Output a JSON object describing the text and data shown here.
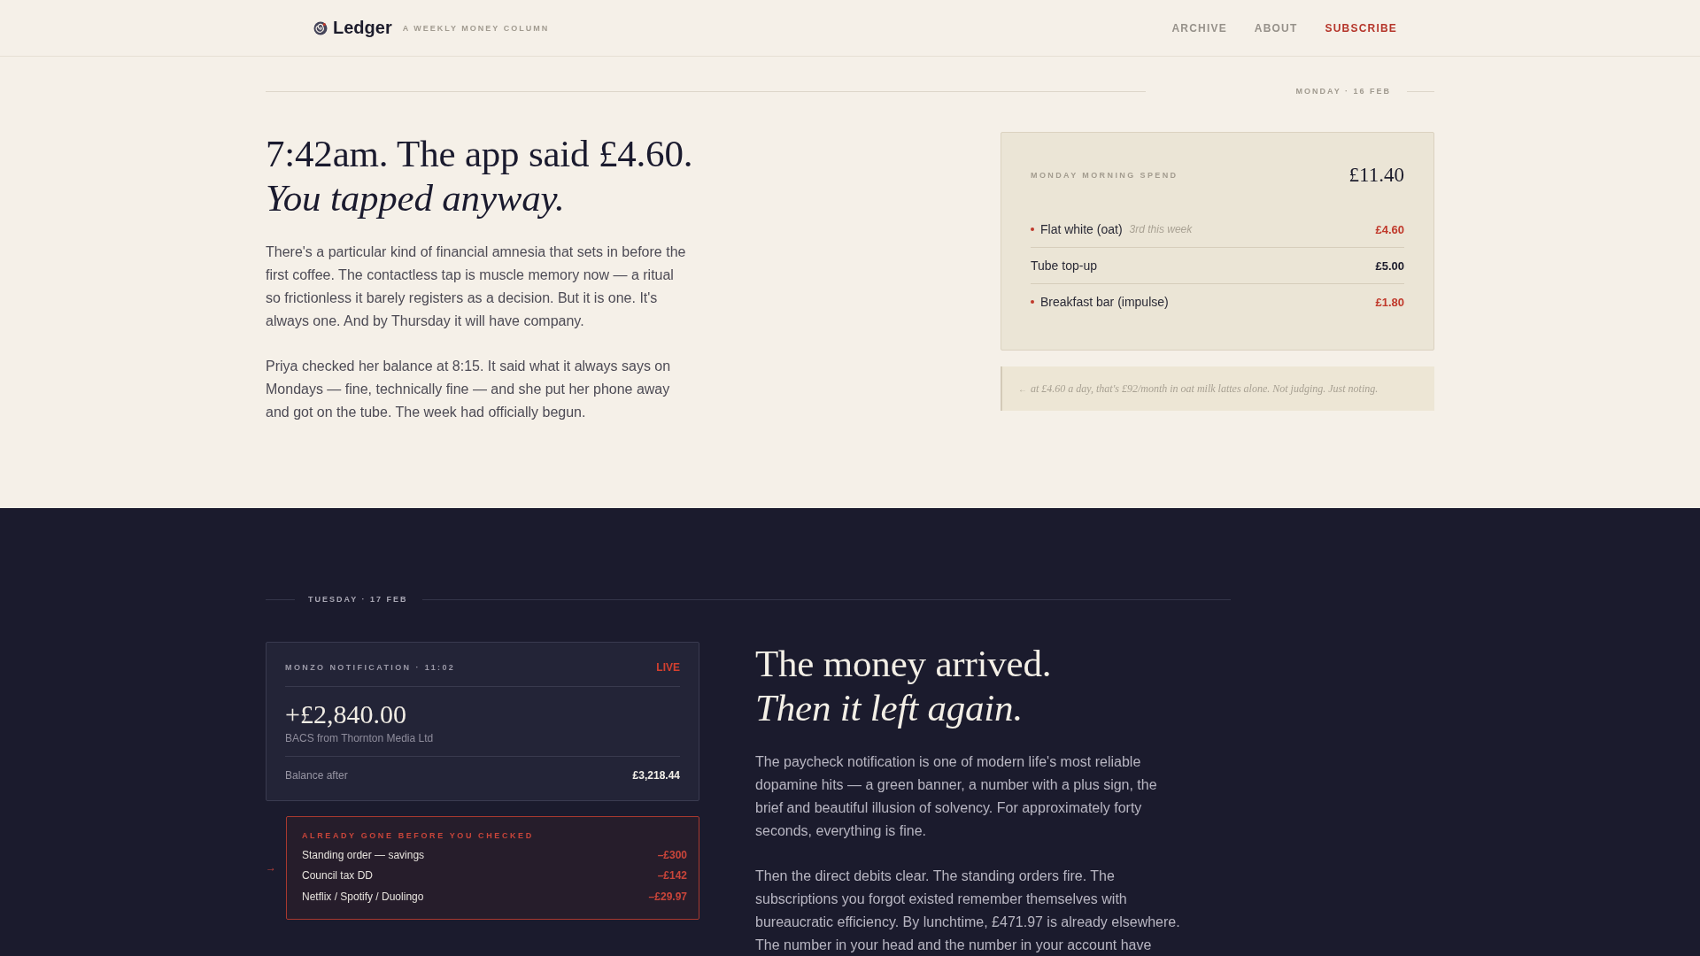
{
  "header": {
    "logo": "Ledger",
    "tagline": "A WEEKLY MONEY COLUMN",
    "nav": [
      {
        "label": "ARCHIVE",
        "kind": "link"
      },
      {
        "label": "ABOUT",
        "kind": "link"
      },
      {
        "label": "SUBSCRIBE",
        "kind": "cta"
      }
    ]
  },
  "monday": {
    "date": "MONDAY · 16 FEB",
    "headline": "7:42am. The app said £4.60. *You tapped anyway.*",
    "paragraphs": [
      "There's a particular kind of financial amnesia that sets in before the first coffee. The contactless tap is muscle memory now — a ritual so frictionless it barely registers as a decision. But it is one. It's always one. And by Thursday it will have company.",
      "Priya checked her balance at 8:15. It said what it always says on Mondays — fine, technically fine — and she put her phone away and got on the tube. The week had officially begun."
    ],
    "spend_card": {
      "label": "MONDAY MORNING SPEND",
      "total": "£11.40",
      "items": [
        {
          "name": "Flat white (oat)",
          "note": "3rd this week",
          "amount": "£4.60",
          "flagged": true
        },
        {
          "name": "Tube top-up",
          "amount": "£5.00",
          "flagged": false
        },
        {
          "name": "Breakfast bar (impulse)",
          "amount": "£1.80",
          "flagged": true
        }
      ]
    },
    "aside": {
      "arrow": "←",
      "text": "at £4.60 a day, that's £92/month in oat milk lattes alone. Not judging. Just noting."
    }
  },
  "tuesday": {
    "date": "TUESDAY · 17 FEB",
    "notification": {
      "label": "MONZO NOTIFICATION · 11:02",
      "status": "LIVE",
      "amount": "+£2,840.00",
      "source": "BACS from Thornton Media Ltd",
      "balance_label": "Balance after",
      "balance": "£3,218.44"
    },
    "gone": {
      "arrow": "→",
      "title": "ALREADY GONE BEFORE YOU CHECKED",
      "items": [
        {
          "name": "Standing order — savings",
          "amount": "–£300"
        },
        {
          "name": "Council tax DD",
          "amount": "–£142"
        },
        {
          "name": "Netflix / Spotify / Duolingo",
          "amount": "–£29.97"
        }
      ]
    },
    "headline": "The money arrived. *Then it left again.*",
    "paragraphs": [
      "The paycheck notification is one of modern life's most reliable dopamine hits — a green banner, a number with a plus sign, the brief and beautiful illusion of solvency. For approximately forty seconds, everything is fine.",
      "Then the direct debits clear. The standing orders fire. The subscriptions you forgot existed remember themselves with bureaucratic efficiency. By lunchtime, £471.97 is already elsewhere. The number in your head and the number in your account have"
    ]
  }
}
